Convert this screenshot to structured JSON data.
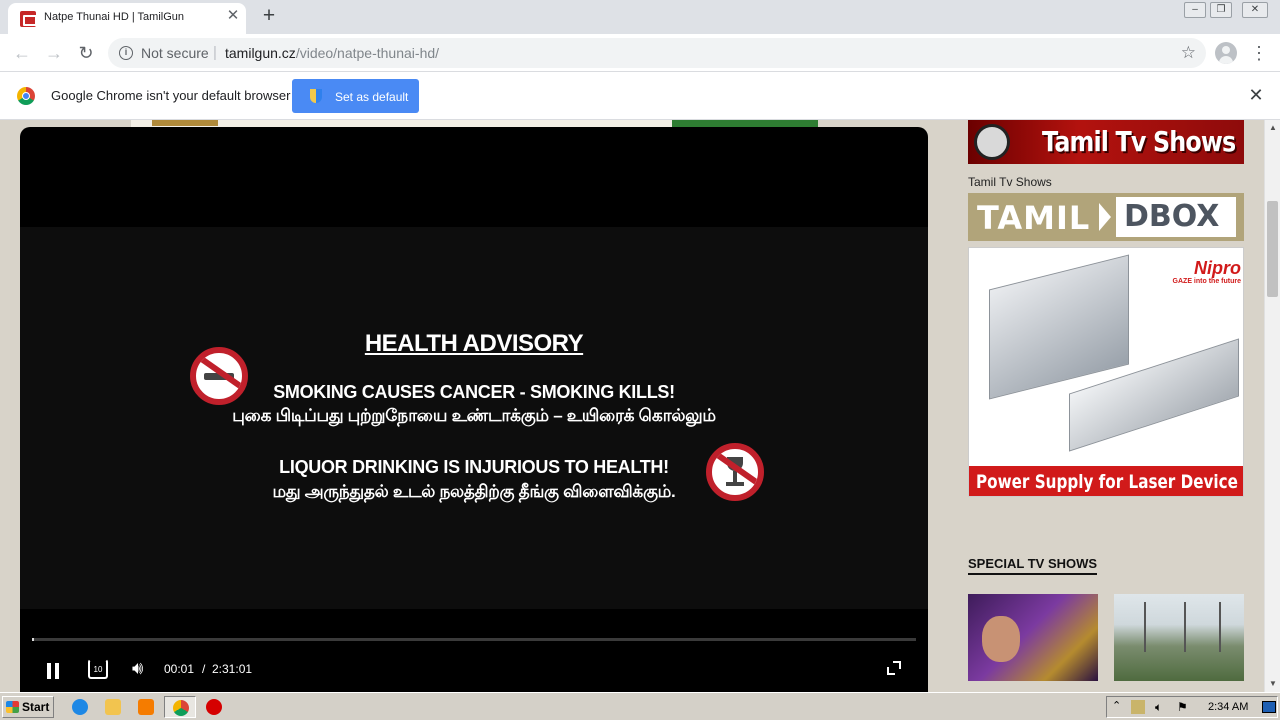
{
  "browser": {
    "tab": {
      "title": "Natpe Thunai HD | TamilGun"
    },
    "address": {
      "security_label": "Not secure",
      "separator": "|",
      "host": "tamilgun.cz",
      "path": "/video/natpe-thunai-hd/"
    },
    "infobar": {
      "message": "Google Chrome isn't your default browser",
      "button_label": "Set as default"
    }
  },
  "player": {
    "advisory": {
      "title": "HEALTH ADVISORY",
      "smoking_en": "SMOKING CAUSES CANCER - SMOKING KILLS!",
      "smoking_ta": "புகை பிடிப்பது புற்றுநோயை உண்டாக்கும் – உயிரைக் கொல்லும்",
      "liquor_en": "LIQUOR DRINKING IS INJURIOUS TO HEALTH!",
      "liquor_ta": "மது அருந்துதல் உடல் நலத்திற்கு தீங்கு விளைவிக்கும்."
    },
    "controls": {
      "current_time": "00:01",
      "separator": "/",
      "total_time": "2:31:01",
      "replay_label": "10",
      "progress_fraction": 0.0
    }
  },
  "sidebar": {
    "banner_text": "Tamil Tv Shows",
    "shows_caption": "Tamil Tv Shows",
    "dbox_left": "TAMIL",
    "dbox_right": "DBOX",
    "ad": {
      "brand": "Nipro",
      "brand_sub": "GAZE into the future",
      "caption": "Power Supply for Laser Device"
    },
    "section_title": "SPECIAL TV SHOWS"
  },
  "taskbar": {
    "start_label": "Start",
    "clock": "2:34 AM"
  }
}
